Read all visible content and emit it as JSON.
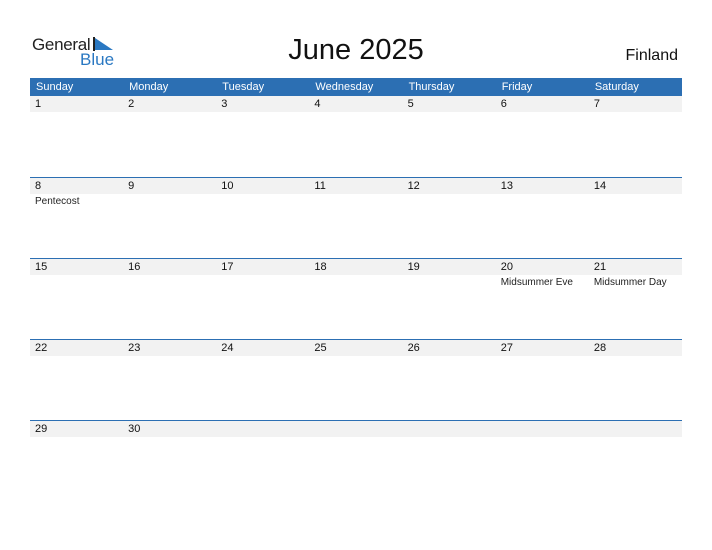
{
  "logo": {
    "general": "General",
    "blue": "Blue"
  },
  "title": "June 2025",
  "country": "Finland",
  "colors": {
    "header": "#2c6fb3",
    "day_band": "#f2f2f2",
    "logo_blue": "#2a78c2"
  },
  "weekdays": [
    "Sunday",
    "Monday",
    "Tuesday",
    "Wednesday",
    "Thursday",
    "Friday",
    "Saturday"
  ],
  "weeks": [
    {
      "days": [
        "1",
        "2",
        "3",
        "4",
        "5",
        "6",
        "7"
      ],
      "holidays": [
        "",
        "",
        "",
        "",
        "",
        "",
        ""
      ]
    },
    {
      "days": [
        "8",
        "9",
        "10",
        "11",
        "12",
        "13",
        "14"
      ],
      "holidays": [
        "Pentecost",
        "",
        "",
        "",
        "",
        "",
        ""
      ]
    },
    {
      "days": [
        "15",
        "16",
        "17",
        "18",
        "19",
        "20",
        "21"
      ],
      "holidays": [
        "",
        "",
        "",
        "",
        "",
        "Midsummer Eve",
        "Midsummer Day"
      ]
    },
    {
      "days": [
        "22",
        "23",
        "24",
        "25",
        "26",
        "27",
        "28"
      ],
      "holidays": [
        "",
        "",
        "",
        "",
        "",
        "",
        ""
      ]
    },
    {
      "days": [
        "29",
        "30",
        "",
        "",
        "",
        "",
        ""
      ],
      "holidays": [
        "",
        "",
        "",
        "",
        "",
        "",
        ""
      ]
    }
  ]
}
